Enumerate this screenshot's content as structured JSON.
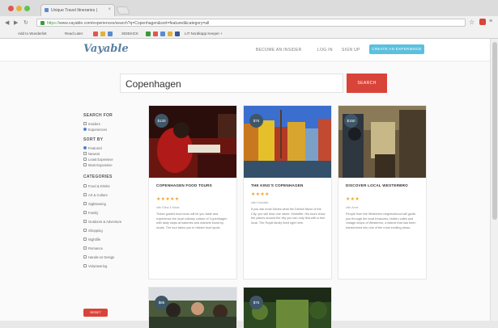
{
  "browser": {
    "tab_title": "Unique Travel Itineraries |",
    "url_https": "https://",
    "url_rest": "www.vayable.com/experiences/search?q=Copenhagen&sort=featured&category=all",
    "bookmarks": [
      "Add to Wunderlist",
      "Read Later",
      "SIDEKICK",
      "LIT Nordkapp Keeper +"
    ]
  },
  "site": {
    "logo": "Vayable",
    "nav": [
      "BECOME AN INSIDER",
      "LOG IN",
      "SIGN UP"
    ],
    "cta": "CREATE AN EXPERIENCE"
  },
  "search": {
    "query": "Copenhagen",
    "button": "SEARCH"
  },
  "sidebar": {
    "search_for_heading": "SEARCH FOR",
    "search_for": [
      "Insiders",
      "Experiences"
    ],
    "sort_heading": "SORT BY",
    "sort": [
      "Featured",
      "Newest",
      "Least Expensive",
      "Most Expensive"
    ],
    "categories_heading": "CATEGORIES",
    "categories": [
      "Food & Drinks",
      "Art & Culture",
      "Sightseeing",
      "Family",
      "Outdoors & Adventure",
      "Shopping",
      "Nightlife",
      "Romance",
      "Hands-on Design",
      "Volunteering"
    ],
    "reset": "RESET"
  },
  "cards": [
    {
      "price": "$120",
      "title": "COPENHAGEN FOOD TOURS",
      "stars": "★★★★★",
      "meta": "with Elina & Mads",
      "desc": "These guided food tours will let you taste and experience the local culinary culture of Copenhagen with tasty stops at bakeries and markets found by locals. The tour takes you to hidden food spots."
    },
    {
      "price": "$75",
      "title": "THE KING'S COPENHAGEN",
      "stars": "★★★★",
      "meta": "with Kristoffer",
      "desc": "If you ask most Danes what the Danish flavor of the City, you will hear one name: Kristoffer. His tours show the places around the city you can only find with a true local. The Royal family lived right here."
    },
    {
      "price": "$150",
      "title": "DISCOVER LOCAL WESTERBRO",
      "stars": "★★★",
      "meta": "with Anne",
      "desc": "People from the Westerbro neighborhood will guide you through the local treasures, hidden cafés and vintage shops of Westerbro, a district that has been transformed into one of the most exciting areas."
    },
    {
      "price": "$85"
    },
    {
      "price": "$75"
    }
  ]
}
